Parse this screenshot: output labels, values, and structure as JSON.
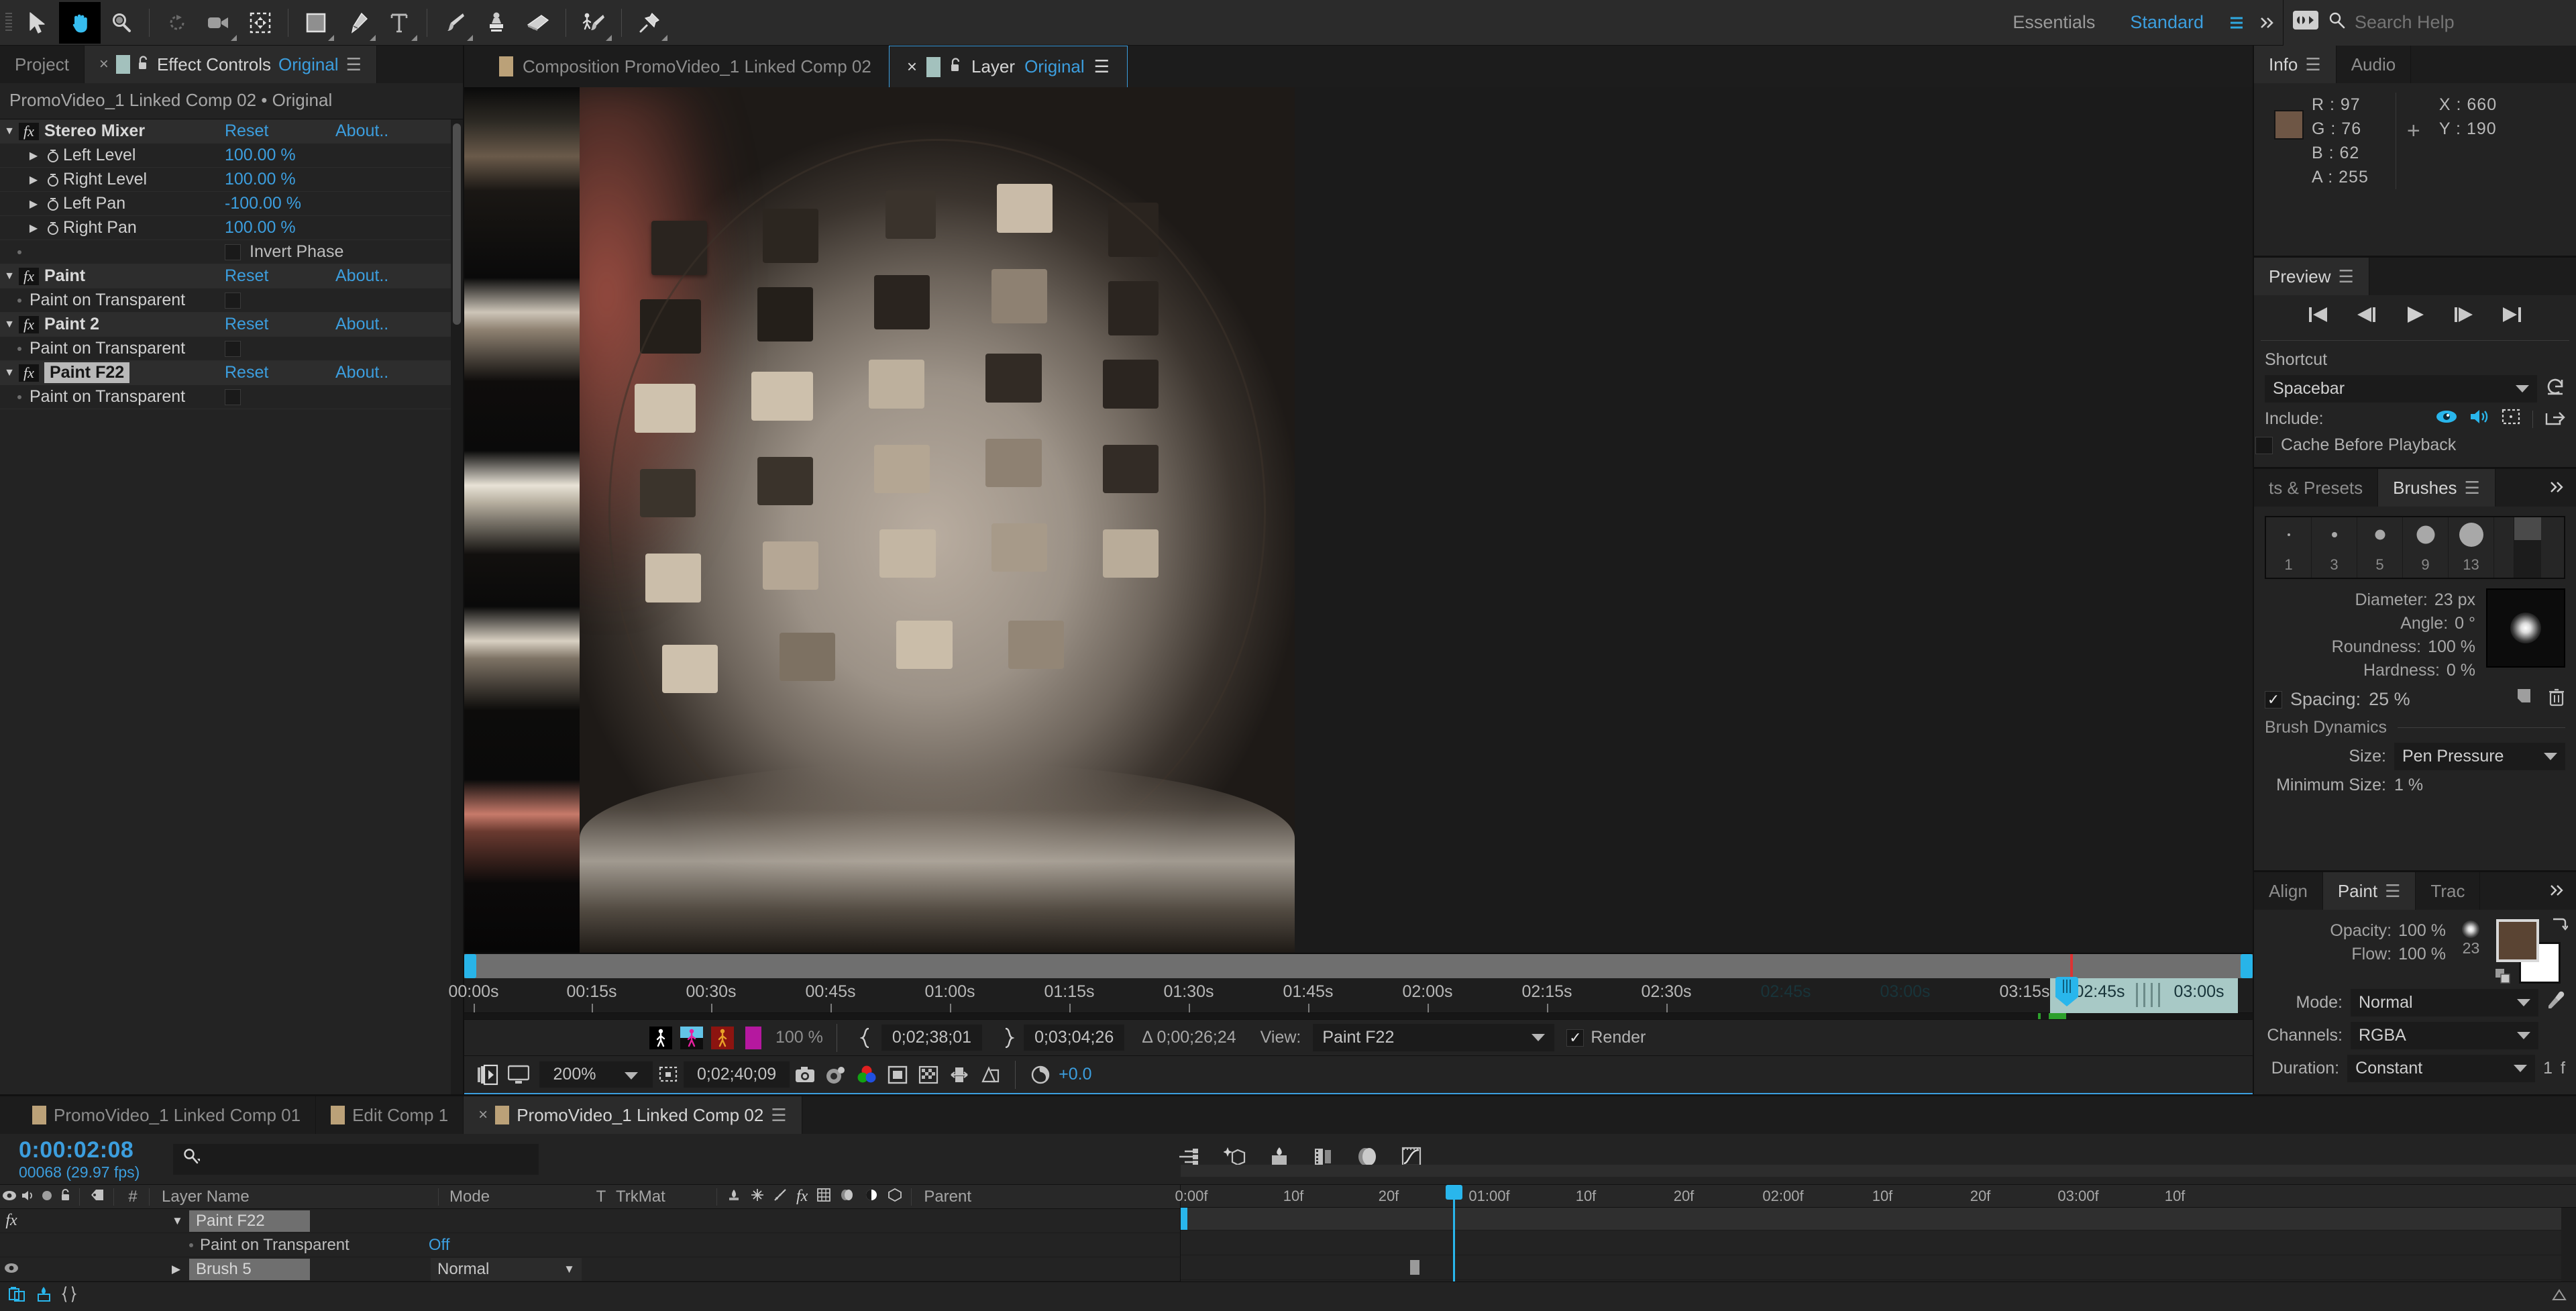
{
  "toolbar": {
    "tools": [
      {
        "name": "selection-tool",
        "title": "Selection Tool"
      },
      {
        "name": "hand-tool",
        "title": "Hand Tool"
      },
      {
        "name": "zoom-tool",
        "title": "Zoom Tool"
      },
      {
        "name": "rotation-tool",
        "title": "Rotation Tool"
      },
      {
        "name": "camera-tool",
        "title": "Unified Camera Tool"
      },
      {
        "name": "pan-behind-tool",
        "title": "Pan Behind Tool"
      },
      {
        "name": "shape-tool",
        "title": "Rectangle Tool"
      },
      {
        "name": "pen-tool",
        "title": "Pen Tool"
      },
      {
        "name": "type-tool",
        "title": "Type Tool"
      },
      {
        "name": "brush-tool",
        "title": "Brush Tool"
      },
      {
        "name": "clone-stamp-tool",
        "title": "Clone Stamp Tool"
      },
      {
        "name": "eraser-tool",
        "title": "Eraser Tool"
      },
      {
        "name": "roto-brush-tool",
        "title": "Roto Brush Tool"
      },
      {
        "name": "puppet-pin-tool",
        "title": "Puppet Pin Tool"
      }
    ],
    "workspace_essentials": "Essentials",
    "workspace_standard": "Standard",
    "search_placeholder": "Search Help",
    "search_value": ""
  },
  "effect_controls": {
    "tabs": [
      {
        "label": "Project",
        "active": false
      },
      {
        "label": "Effect Controls",
        "suffix": "Original",
        "active": true
      }
    ],
    "subtitle": "PromoVideo_1 Linked Comp 02 • Original",
    "reset_label": "Reset",
    "about_label": "About..",
    "rows": [
      {
        "type": "effect",
        "name": "Stereo Mixer",
        "action": "Reset",
        "about": "About.."
      },
      {
        "type": "prop",
        "name": "Left Level",
        "value": "100.00 %"
      },
      {
        "type": "prop",
        "name": "Right Level",
        "value": "100.00 %"
      },
      {
        "type": "prop",
        "name": "Left Pan",
        "value": "-100.00 %"
      },
      {
        "type": "prop",
        "name": "Right Pan",
        "value": "100.00 %"
      },
      {
        "type": "check-right",
        "name": "",
        "checkbox_label": "Invert Phase",
        "checked": false
      },
      {
        "type": "effect",
        "name": "Paint",
        "action": "Reset",
        "about": "About.."
      },
      {
        "type": "check",
        "name": "Paint on Transparent",
        "checked": false
      },
      {
        "type": "effect",
        "name": "Paint 2",
        "action": "Reset",
        "about": "About.."
      },
      {
        "type": "check",
        "name": "Paint on Transparent",
        "checked": false
      },
      {
        "type": "effect",
        "name": "Paint F22",
        "action": "Reset",
        "about": "About..",
        "selected": true
      },
      {
        "type": "check",
        "name": "Paint on Transparent",
        "checked": false
      }
    ]
  },
  "viewer": {
    "tabs": [
      {
        "label": "Composition PromoVideo_1 Linked Comp 02",
        "active": false
      },
      {
        "label": "Layer",
        "suffix": "Original",
        "active": true
      }
    ],
    "ruler_labels": [
      "00:00s",
      "00:15s",
      "00:30s",
      "00:45s",
      "01:00s",
      "01:15s",
      "01:30s",
      "01:45s",
      "02:00s",
      "02:15s",
      "02:30s",
      "02:45s",
      "03:00s",
      "03:15s"
    ],
    "work_area_labels": [
      "02:45s",
      "03:00s"
    ],
    "controls": {
      "transparency_grid": "100 %",
      "in_point": "0;02;38;01",
      "out_point": "0;03;04;26",
      "duration": "Δ 0;00;26;24",
      "view_label": "View:",
      "view_value": "Paint F22",
      "render_label": "Render",
      "render_checked": true
    },
    "bottombar": {
      "zoom": "200%",
      "timecode": "0;02;40;09",
      "exposure": "+0.0"
    }
  },
  "info": {
    "tabs": [
      {
        "label": "Info",
        "active": true
      },
      {
        "label": "Audio",
        "active": false
      }
    ],
    "r_label": "R :",
    "r": "97",
    "g_label": "G :",
    "g": "76",
    "b_label": "B :",
    "b": "62",
    "a_label": "A :",
    "a": "255",
    "x_label": "X :",
    "x": "660",
    "y_label": "Y :",
    "y": "190",
    "swatch_color": "#6e5645"
  },
  "preview": {
    "title": "Preview",
    "shortcut_label": "Shortcut",
    "shortcut_value": "Spacebar",
    "include_label": "Include:",
    "cache_label": "Cache Before Playback",
    "cache_checked": false
  },
  "brushes": {
    "tabs": [
      {
        "label": "ts & Presets",
        "active": false
      },
      {
        "label": "Brushes",
        "active": true
      }
    ],
    "presets": [
      {
        "num": "1",
        "size": 4
      },
      {
        "num": "3",
        "size": 8
      },
      {
        "num": "5",
        "size": 15
      },
      {
        "num": "9",
        "size": 27
      },
      {
        "num": "13",
        "size": 36
      }
    ],
    "diameter_label": "Diameter:",
    "diameter": "23 px",
    "angle_label": "Angle:",
    "angle": "0 °",
    "roundness_label": "Roundness:",
    "roundness": "100 %",
    "hardness_label": "Hardness:",
    "hardness": "0 %",
    "spacing_label": "Spacing:",
    "spacing": "25 %",
    "spacing_checked": true,
    "dynamics_title": "Brush Dynamics",
    "size_label": "Size:",
    "size_value": "Pen Pressure",
    "min_size_label": "Minimum Size:",
    "min_size": "1 %"
  },
  "paint": {
    "tabs": [
      {
        "label": "Align",
        "active": false
      },
      {
        "label": "Paint",
        "active": true
      },
      {
        "label": "Trac",
        "active": false
      }
    ],
    "opacity_label": "Opacity:",
    "opacity": "100 %",
    "flow_label": "Flow:",
    "flow": "100 %",
    "brush_size": "23",
    "mode_label": "Mode:",
    "mode": "Normal",
    "channels_label": "Channels:",
    "channels": "RGBA",
    "duration_label": "Duration:",
    "duration": "Constant",
    "duration_frames": "1",
    "duration_unit": "f",
    "fg_color": "#5a4433",
    "bg_color": "#ffffff"
  },
  "timeline": {
    "tabs": [
      {
        "label": "PromoVideo_1 Linked Comp 01",
        "active": false
      },
      {
        "label": "Edit Comp 1",
        "active": false
      },
      {
        "label": "PromoVideo_1 Linked Comp 02",
        "active": true
      }
    ],
    "current_time": "0:00:02:08",
    "frame_info": "00068 (29.97 fps)",
    "search_value": "",
    "columns": [
      "#",
      "Layer Name",
      "Mode",
      "T",
      "TrkMat",
      "Parent"
    ],
    "rows": [
      {
        "indicator": "fx",
        "twirl": "▼",
        "name": "Paint F22",
        "mode": "",
        "selected": true
      },
      {
        "indicator": "",
        "twirl": "",
        "name": "Paint on Transparent",
        "value": "Off",
        "indent": true
      },
      {
        "indicator": "eye",
        "twirl": "▶",
        "name": "Brush 5",
        "mode": "Normal",
        "selected": true
      }
    ],
    "ruler_labels": [
      "0:00f",
      "10f",
      "20f",
      "01:00f",
      "10f",
      "20f",
      "02:00f",
      "10f",
      "20f",
      "03:00f",
      "10f"
    ]
  }
}
